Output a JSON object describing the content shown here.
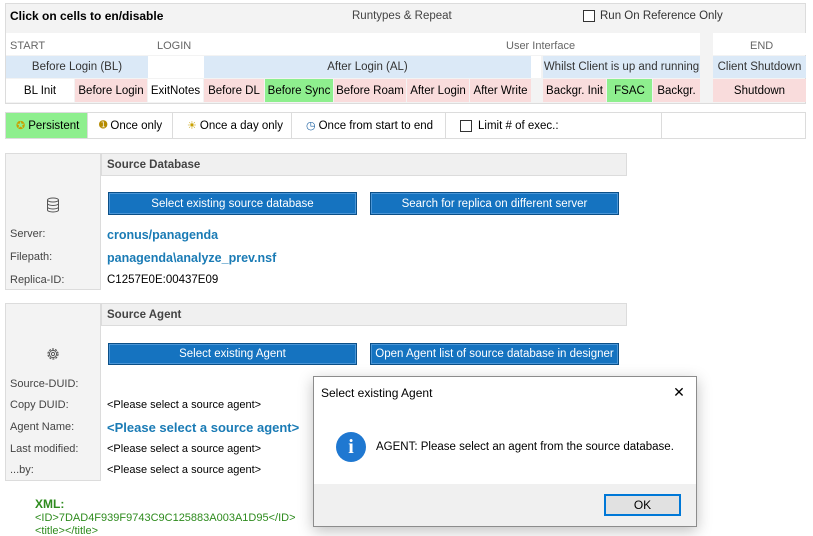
{
  "header": {
    "instruction": "Click on cells to en/disable",
    "runtypes_label": "Runtypes & Repeat",
    "run_on_reference_label": "Run On Reference Only"
  },
  "phases": {
    "start": "START",
    "login": "LOGIN",
    "user_interface": "User Interface",
    "end": "END"
  },
  "groups": {
    "before_login": "Before Login (BL)",
    "after_login": "After Login (AL)",
    "whilst_client": "Whilst Client is up and running",
    "client_shutdown": "Client Shutdown"
  },
  "cells": [
    "BL Init",
    "Before Login",
    "ExitNotes",
    "Before DL",
    "Before Sync",
    "Before Roam",
    "After Login",
    "After Write",
    "Backgr. Init",
    "FSAC",
    "Backgr.",
    "Shutdown"
  ],
  "repeat_options": {
    "persistent": "Persistent",
    "once_only": "Once only",
    "once_a_day": "Once a day only",
    "once_start_end": "Once from start to end",
    "limit": "Limit # of exec.:"
  },
  "source_db": {
    "title": "Source Database",
    "select_btn": "Select existing source database",
    "search_btn": "Search for replica on different server",
    "server_label": "Server:",
    "server_value": "cronus/panagenda",
    "filepath_label": "Filepath:",
    "filepath_value": "panagenda\\analyze_prev.nsf",
    "replica_label": "Replica-ID:",
    "replica_value": "C1257E0E:00437E09"
  },
  "source_agent": {
    "title": "Source Agent",
    "select_btn": "Select existing Agent",
    "open_btn": "Open Agent list of source database in designer",
    "duid_label": "Source-DUID:",
    "copy_label": "Copy DUID:",
    "copy_value": "<Please select a source agent>",
    "name_label": "Agent Name:",
    "name_value": "<Please select a source agent>",
    "modified_label": "Last modified:",
    "modified_value": "<Please select a source agent>",
    "by_label": "...by:",
    "by_value": "<Please select a source agent>"
  },
  "xml": {
    "label": "XML:",
    "line1": "<ID>7DAD4F939F9743C9C125883A003A1D95</ID>",
    "line2": "<title></title>"
  },
  "dialog": {
    "title": "Select existing Agent",
    "message": "AGENT: Please select an agent from the source database.",
    "ok": "OK",
    "close": "✕"
  },
  "colors": {
    "accent_blue": "#1573c0",
    "enabled_green": "#8eef8e",
    "disabled_pink": "#f9dcdc",
    "header_blue": "#dbe9f7",
    "xml_green": "#2e8b1e"
  }
}
